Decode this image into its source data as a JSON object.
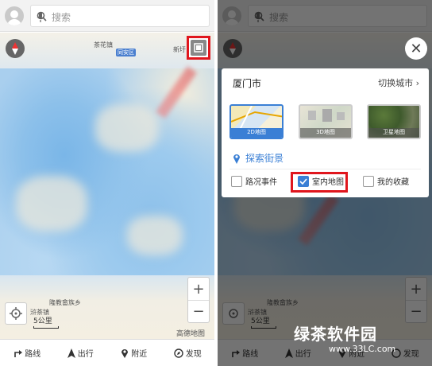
{
  "search": {
    "placeholder": "搜索"
  },
  "map": {
    "labels": [
      "茶花镇",
      "同安区",
      "新圩",
      "隆教畲族乡",
      "浒茶镇"
    ],
    "scale": "5公里",
    "provider": "高德地图"
  },
  "nav": [
    {
      "label": "路线",
      "icon": "route-icon"
    },
    {
      "label": "出行",
      "icon": "navigate-arrow-icon"
    },
    {
      "label": "附近",
      "icon": "location-pin-icon"
    },
    {
      "label": "发现",
      "icon": "compass-discover-icon"
    }
  ],
  "popup": {
    "city": "厦门市",
    "switch_city": "切换城市",
    "map_types": [
      {
        "label": "2D地图",
        "selected": true
      },
      {
        "label": "3D地图",
        "selected": false
      },
      {
        "label": "卫星地图",
        "selected": false
      }
    ],
    "street_view": "探索街景",
    "options": [
      {
        "label": "路况事件",
        "checked": false
      },
      {
        "label": "室内地图",
        "checked": true
      },
      {
        "label": "我的收藏",
        "checked": false
      }
    ]
  },
  "watermark": {
    "title": "绿茶软件园",
    "url": "www.33LC.com"
  },
  "colors": {
    "highlight": "#e0161d",
    "accent": "#3a7fd5"
  }
}
